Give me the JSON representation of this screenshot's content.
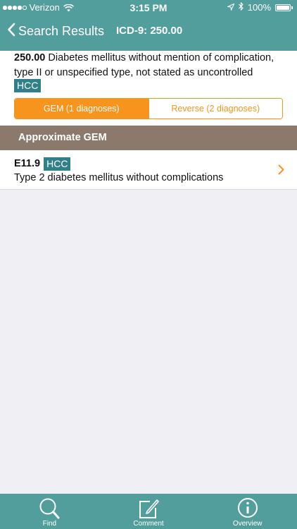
{
  "status_bar": {
    "carrier": "Verizon",
    "time": "3:15 PM",
    "battery": "100%"
  },
  "nav": {
    "back_label": "Search Results",
    "title": "ICD-9: 250.00"
  },
  "detail": {
    "code": "250.00",
    "description": "Diabetes mellitus without mention of complication, type II or unspecified type, not stated as uncontrolled",
    "badge": "HCC"
  },
  "segments": {
    "gem_label": "GEM (1 diagnoses)",
    "reverse_label": "Reverse (2 diagnoses)",
    "selected": "GEM (1 diagnoses)"
  },
  "section": {
    "title": "Approximate GEM"
  },
  "results": [
    {
      "code": "E11.9",
      "badge": "HCC",
      "description": "Type 2 diabetes mellitus without complications"
    }
  ],
  "tabs": [
    {
      "label": "Find",
      "icon": "magnifier-icon"
    },
    {
      "label": "Comment",
      "icon": "compose-icon"
    },
    {
      "label": "Overview",
      "icon": "info-icon"
    }
  ],
  "colors": {
    "header": "#529e9c",
    "accent": "#f7941d",
    "badge": "#2f8088",
    "section_header": "#8b7a6c",
    "background": "#efeff4"
  }
}
